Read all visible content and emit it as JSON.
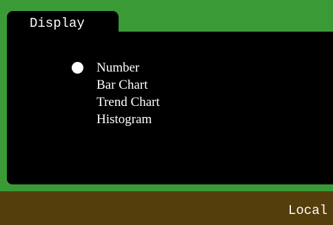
{
  "tab": {
    "label": "Display"
  },
  "display_options": {
    "selected": "Number",
    "items": [
      {
        "label": "Number",
        "selected": true
      },
      {
        "label": "Bar Chart",
        "selected": false
      },
      {
        "label": "Trend Chart",
        "selected": false
      },
      {
        "label": "Histogram",
        "selected": false
      }
    ]
  },
  "status_bar": {
    "mode": "Local"
  },
  "colors": {
    "frame": "#3a9b36",
    "panel": "#000000",
    "status_bar": "#543e0c",
    "text": "#ffffff"
  }
}
